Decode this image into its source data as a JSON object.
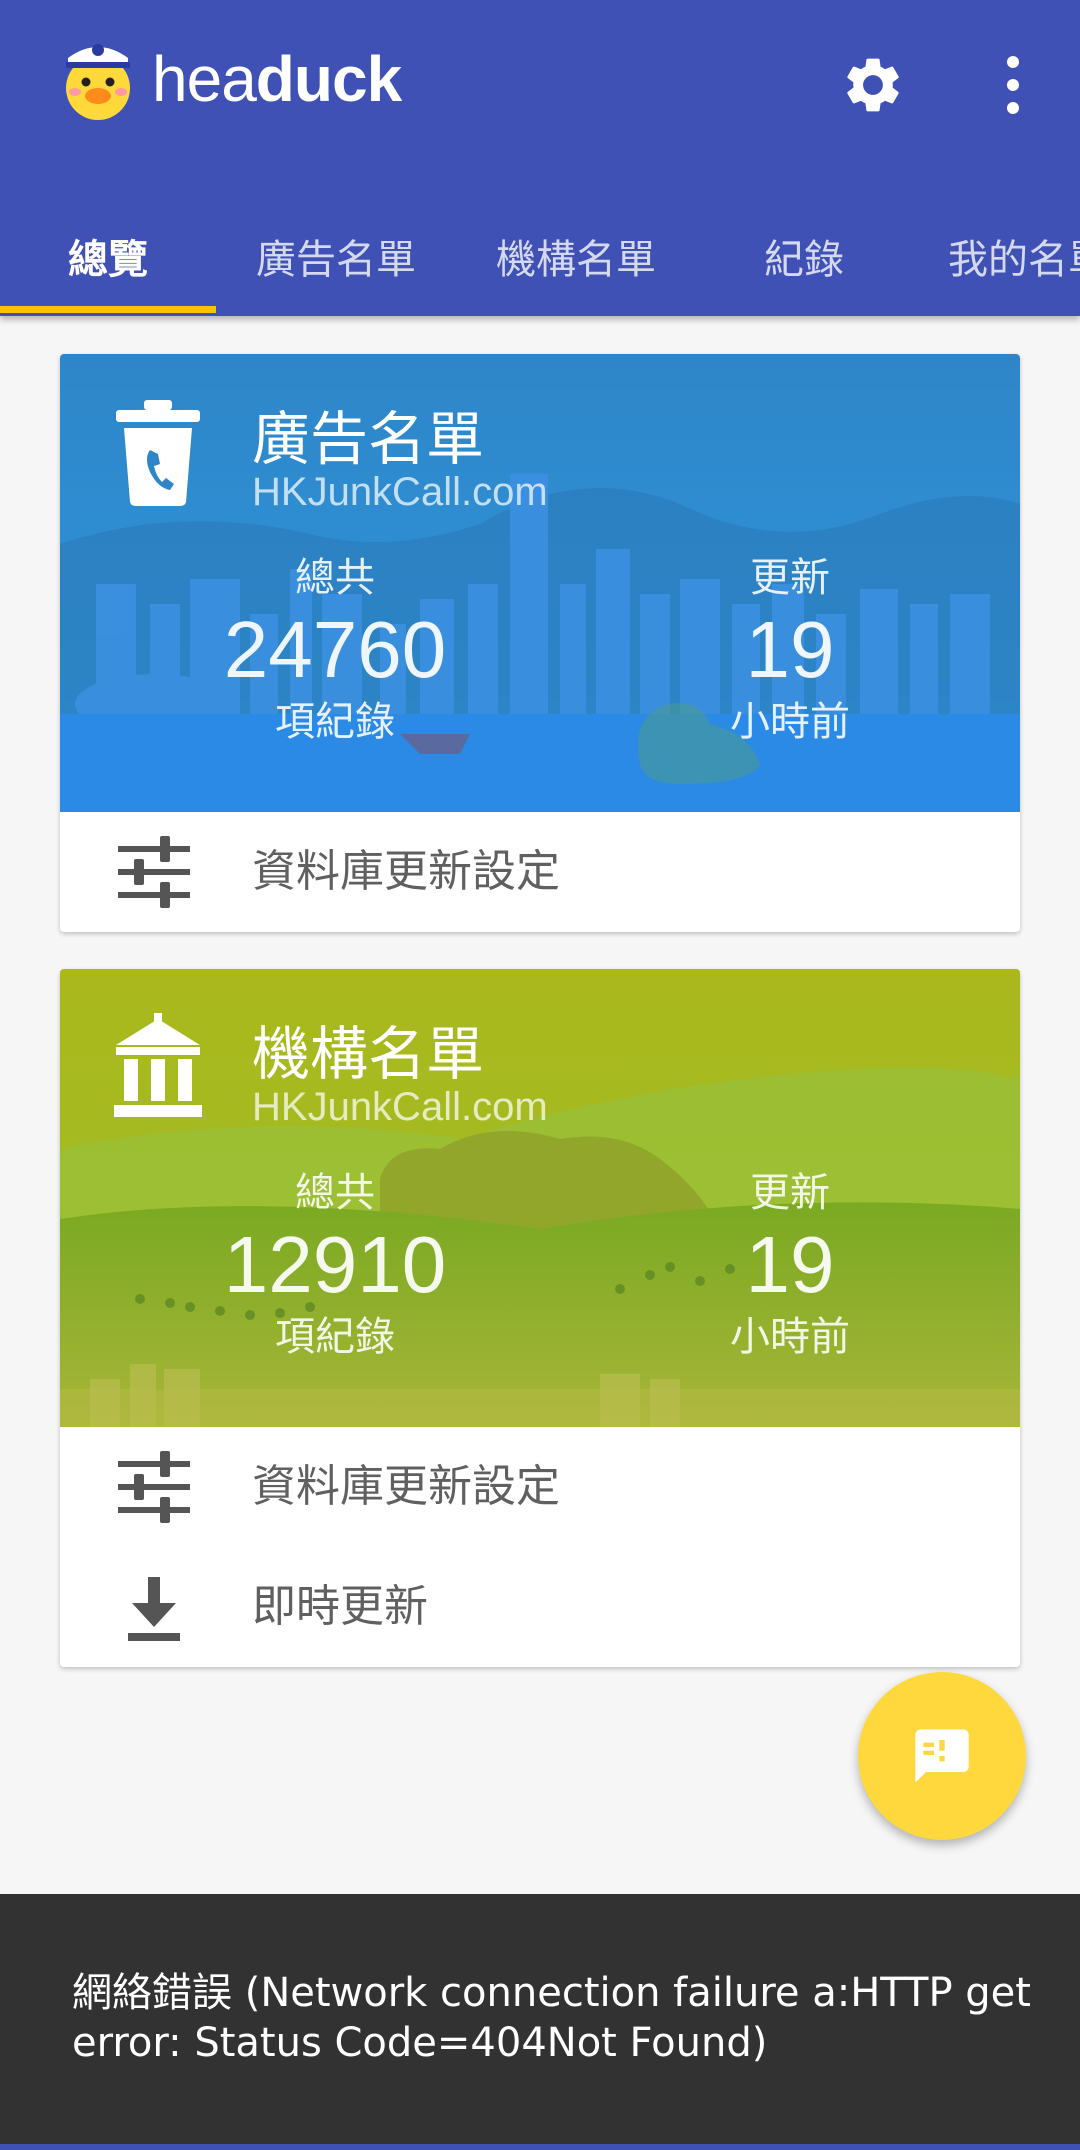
{
  "app": {
    "title_light": "hea",
    "title_bold": "duck",
    "logo_icon": "duck-police-mascot-icon",
    "settings_icon": "gear-icon",
    "menu_icon": "more-vert-icon"
  },
  "tabs": [
    {
      "label": "總覽",
      "active": true
    },
    {
      "label": "廣告名單",
      "active": false
    },
    {
      "label": "機構名單",
      "active": false
    },
    {
      "label": "紀錄",
      "active": false
    },
    {
      "label": "我的名單",
      "active": false
    }
  ],
  "cards": [
    {
      "icon": "trash-phone-icon",
      "title": "廣告名單",
      "subtitle": "HKJunkCall.com",
      "total_label": "總共",
      "total_value": "24760",
      "total_unit": "項紀錄",
      "updated_label": "更新",
      "updated_value": "19",
      "updated_unit": "小時前",
      "actions": [
        {
          "icon": "sliders-icon",
          "label": "資料庫更新設定"
        }
      ]
    },
    {
      "icon": "bank-building-icon",
      "title": "機構名單",
      "subtitle": "HKJunkCall.com",
      "total_label": "總共",
      "total_value": "12910",
      "total_unit": "項紀錄",
      "updated_label": "更新",
      "updated_value": "19",
      "updated_unit": "小時前",
      "actions": [
        {
          "icon": "sliders-icon",
          "label": "資料庫更新設定"
        },
        {
          "icon": "download-icon",
          "label": "即時更新"
        }
      ]
    }
  ],
  "fab": {
    "icon": "feedback-alert-icon"
  },
  "snackbar": {
    "message": "網絡錯誤 (Network connection failure a:HTTP get error: Status Code=404Not Found)"
  },
  "colors": {
    "primary": "#3f51b5",
    "accent": "#ffc107",
    "fab": "#ffd83e",
    "card1_sky": "#2f8fd8",
    "card2_sky": "#a8bd1f",
    "snackbar": "#323232"
  }
}
